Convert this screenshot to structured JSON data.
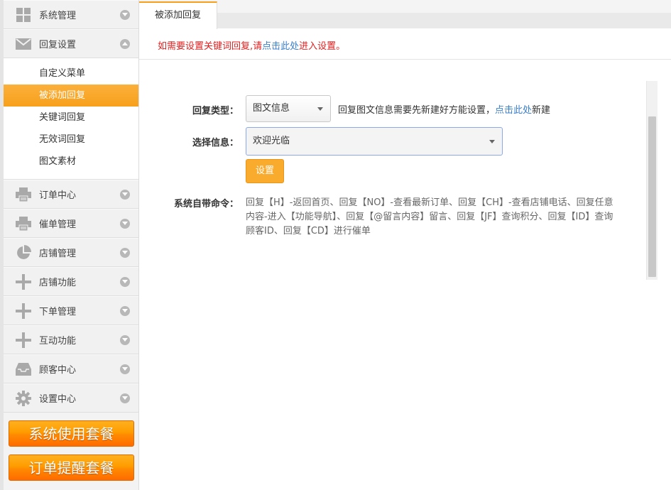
{
  "sidebar": {
    "groups_top": [
      {
        "label": "系统管理",
        "icon": "grid-icon"
      },
      {
        "label": "回复设置",
        "icon": "envelope-icon"
      }
    ],
    "submenu": [
      {
        "label": "自定义菜单",
        "active": false
      },
      {
        "label": "被添加回复",
        "active": true
      },
      {
        "label": "关键词回复",
        "active": false
      },
      {
        "label": "无效词回复",
        "active": false
      },
      {
        "label": "图文素材",
        "active": false
      }
    ],
    "groups_bottom": [
      {
        "label": "订单中心",
        "icon": "printer-icon"
      },
      {
        "label": "催单管理",
        "icon": "printer-icon"
      },
      {
        "label": "店铺管理",
        "icon": "pie-chart-icon"
      },
      {
        "label": "店铺功能",
        "icon": "plus-icon"
      },
      {
        "label": "下单管理",
        "icon": "plus-icon"
      },
      {
        "label": "互动功能",
        "icon": "plus-icon"
      },
      {
        "label": "顾客中心",
        "icon": "inbox-icon"
      },
      {
        "label": "设置中心",
        "icon": "gear-icon"
      }
    ],
    "packages": [
      "系统使用套餐",
      "订单提醒套餐"
    ]
  },
  "main": {
    "tab_label": "被添加回复",
    "notice": {
      "prefix": "如需要设置关键词回复,请",
      "link": "点击此处",
      "suffix": "进入设置。"
    },
    "reply_type": {
      "label": "回复类型：",
      "value": "图文信息",
      "hint_prefix": "回复图文信息需要先新建好方能设置，",
      "hint_link": "点击此处",
      "hint_suffix": "新建"
    },
    "select_info": {
      "label": "选择信息：",
      "value": "欢迎光临"
    },
    "set_button": "设置",
    "commands": {
      "label": "系统自带命令：",
      "text": "回复【H】-返回首页、回复【NO】-查看最新订单、回复【CH】-查看店铺电话、回复任意内容-进入【功能导航】、回复【@留言内容】留言、回复【JF】查询积分、回复【ID】查询顾客ID、回复【CD】进行催单"
    }
  },
  "colors": {
    "accent": "#f7a01c",
    "notice_red": "#e02020",
    "link_blue": "#3a7fd0"
  }
}
